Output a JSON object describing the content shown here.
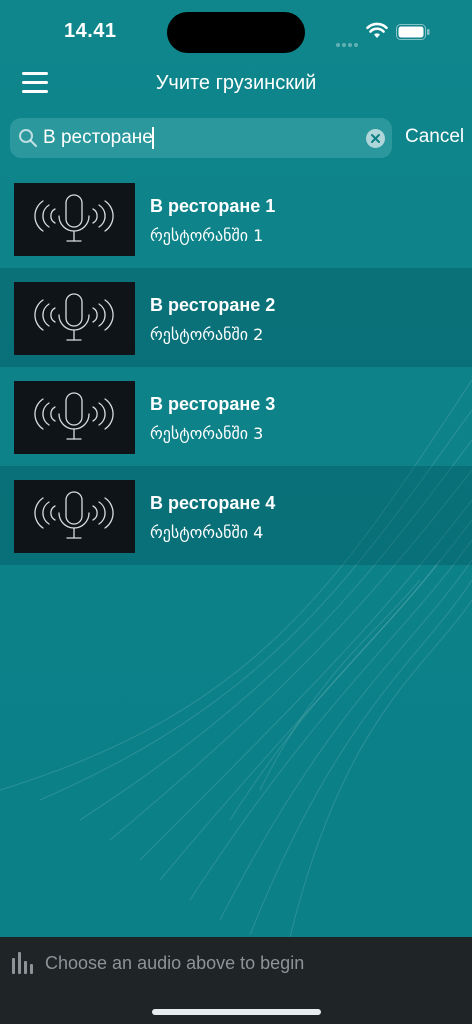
{
  "status_bar": {
    "time": "14.41"
  },
  "nav": {
    "title": "Учите грузинский"
  },
  "search": {
    "value": "В ресторане",
    "cancel_label": "Cancel"
  },
  "items": [
    {
      "title": "В ресторане 1",
      "subtitle": "რესტორანში 1"
    },
    {
      "title": "В ресторане 2",
      "subtitle": "რესტორანში 2"
    },
    {
      "title": "В ресторане 3",
      "subtitle": "რესტორანში 3"
    },
    {
      "title": "В ресторане 4",
      "subtitle": "რესტორანში 4"
    }
  ],
  "player": {
    "status_text": "Choose an audio above to begin"
  },
  "colors": {
    "background": "#0d8289",
    "player_bar": "#1f2427",
    "thumbnail": "#0e1418"
  },
  "icons": {
    "menu": "hamburger-icon",
    "search": "magnifier-icon",
    "clear": "x-circle-icon",
    "thumbnail": "microphone-waves-icon",
    "player": "audio-bars-icon"
  }
}
